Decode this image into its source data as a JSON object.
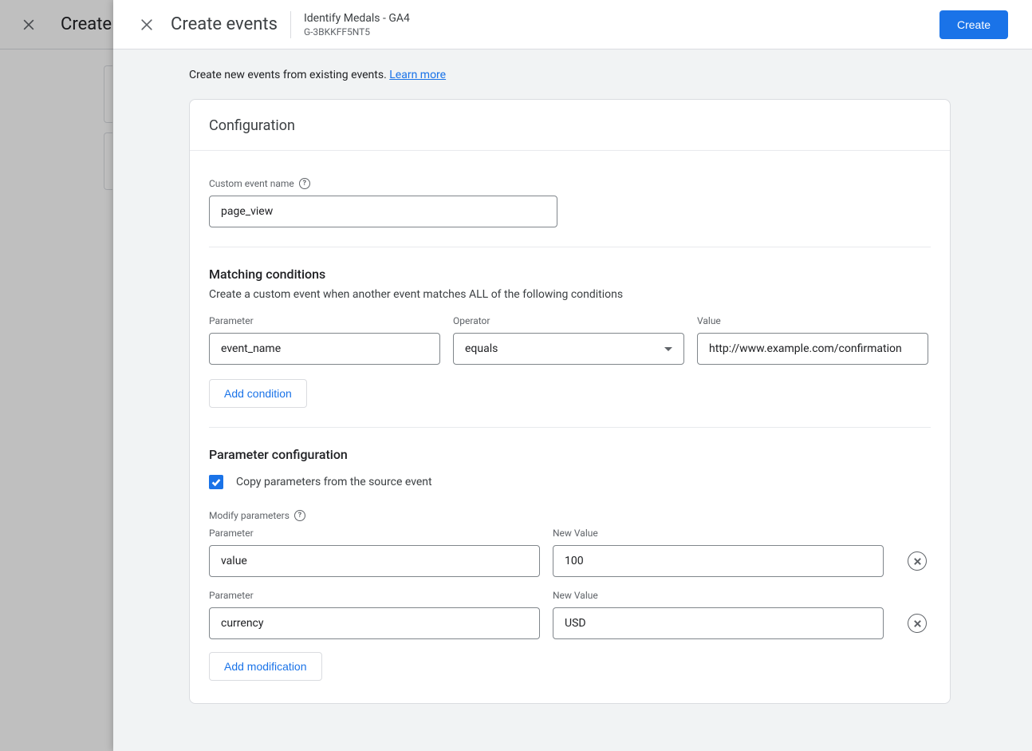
{
  "background": {
    "title": "Create"
  },
  "header": {
    "title": "Create events",
    "property_name": "Identify Medals - GA4",
    "property_id": "G-3BKKFF5NT5",
    "create_label": "Create"
  },
  "intro": {
    "text": "Create new events from existing events. ",
    "link": "Learn more"
  },
  "config": {
    "title": "Configuration",
    "custom_event_label": "Custom event name",
    "custom_event_value": "page_view",
    "matching": {
      "heading": "Matching conditions",
      "subheading": "Create a custom event when another event matches ALL of the following conditions",
      "parameter_label": "Parameter",
      "operator_label": "Operator",
      "value_label": "Value",
      "row": {
        "parameter": "event_name",
        "operator": "equals",
        "value": "http://www.example.com/confirmation"
      },
      "add_condition_label": "Add condition"
    },
    "params": {
      "heading": "Parameter configuration",
      "copy_label": "Copy parameters from the source event",
      "modify_label": "Modify parameters",
      "parameter_label": "Parameter",
      "new_value_label": "New Value",
      "rows": [
        {
          "parameter": "value",
          "new_value": "100"
        },
        {
          "parameter": "currency",
          "new_value": "USD"
        }
      ],
      "add_modification_label": "Add modification"
    }
  }
}
